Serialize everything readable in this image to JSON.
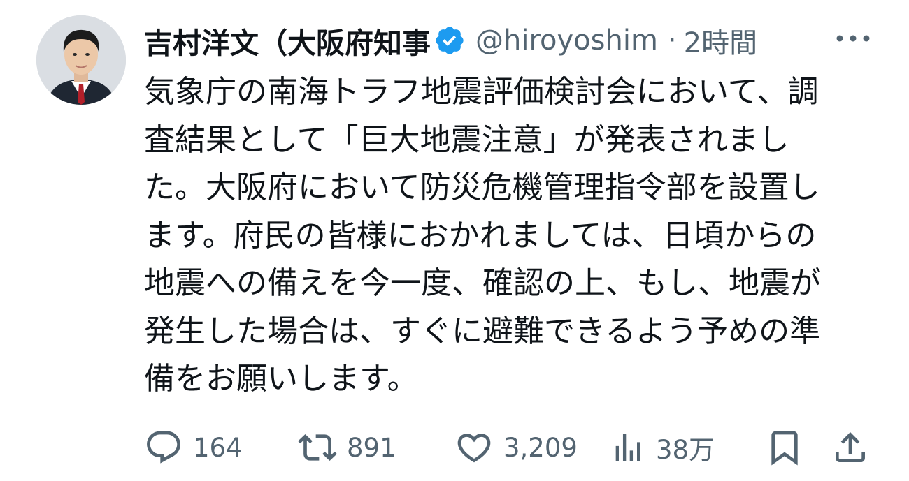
{
  "tweet": {
    "display_name": "吉村洋文（大阪府知事",
    "handle": "@hiroyoshim",
    "separator": "·",
    "time": "2時間",
    "verified": true,
    "body_lines": [
      "気象庁の南海トラフ地震評価検討会において、調",
      "査結果として「巨大地震注意」が発表されまし",
      "た。大阪府において防災危機管理指令部を設置し",
      "ます。府民の皆様におかれましては、日頃からの",
      "地震への備えを今一度、確認の上、もし、地震が",
      "発生した場合は、すぐに避難できるよう予めの準",
      "備をお願いします。"
    ]
  },
  "actions": {
    "reply_count": "164",
    "retweet_count": "891",
    "like_count": "3,209",
    "views_count": "38万"
  },
  "icons": {
    "verified": "verified-badge-icon",
    "more": "more-icon",
    "reply": "reply-icon",
    "retweet": "retweet-icon",
    "like": "heart-icon",
    "views": "views-icon",
    "bookmark": "bookmark-icon",
    "share": "share-icon"
  },
  "colors": {
    "text": "#0f1419",
    "secondary": "#536471",
    "verified_blue": "#1d9bf0"
  }
}
